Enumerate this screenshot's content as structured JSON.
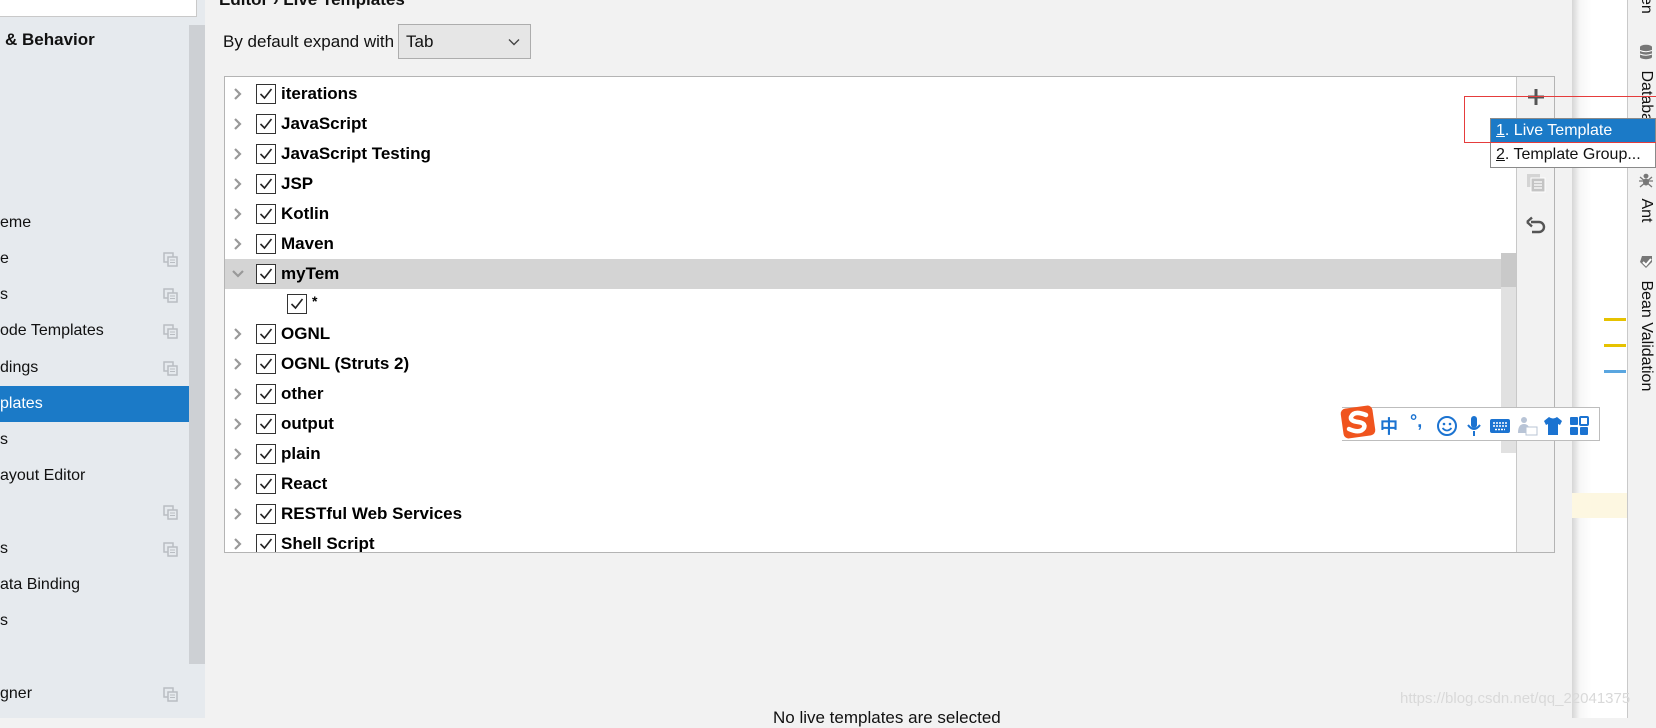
{
  "sidebar": {
    "header": "& Behavior",
    "items": [
      {
        "label": "eme",
        "has_copy": false,
        "selected": false
      },
      {
        "label": "e",
        "has_copy": true,
        "selected": false
      },
      {
        "label": "s",
        "has_copy": true,
        "selected": false
      },
      {
        "label": "ode Templates",
        "has_copy": true,
        "selected": false
      },
      {
        "label": "dings",
        "has_copy": true,
        "selected": false
      },
      {
        "label": "plates",
        "has_copy": false,
        "selected": true
      },
      {
        "label": "s",
        "has_copy": false,
        "selected": false
      },
      {
        "label": "ayout Editor",
        "has_copy": false,
        "selected": false
      },
      {
        "label": "",
        "has_copy": true,
        "selected": false
      },
      {
        "label": "s",
        "has_copy": true,
        "selected": false
      },
      {
        "label": "ata Binding",
        "has_copy": false,
        "selected": false
      },
      {
        "label": "s",
        "has_copy": false,
        "selected": false
      },
      {
        "label": "gner",
        "has_copy": true,
        "selected": false
      }
    ]
  },
  "main": {
    "breadcrumb": "Editor  ›  Live Templates",
    "expand_label": "By default expand with",
    "expand_value": "Tab",
    "help_text": "No live templates are selected"
  },
  "template_groups": [
    {
      "label": "iterations",
      "checked": true,
      "expanded": false,
      "level": 0
    },
    {
      "label": "JavaScript",
      "checked": true,
      "expanded": false,
      "level": 0
    },
    {
      "label": "JavaScript Testing",
      "checked": true,
      "expanded": false,
      "level": 0
    },
    {
      "label": "JSP",
      "checked": true,
      "expanded": false,
      "level": 0
    },
    {
      "label": "Kotlin",
      "checked": true,
      "expanded": false,
      "level": 0
    },
    {
      "label": "Maven",
      "checked": true,
      "expanded": false,
      "level": 0
    },
    {
      "label": "myTem",
      "checked": true,
      "expanded": true,
      "level": 0,
      "selected": true
    },
    {
      "label": "*",
      "checked": true,
      "expanded": false,
      "level": 1
    },
    {
      "label": "OGNL",
      "checked": true,
      "expanded": false,
      "level": 0
    },
    {
      "label": "OGNL (Struts 2)",
      "checked": true,
      "expanded": false,
      "level": 0
    },
    {
      "label": "other",
      "checked": true,
      "expanded": false,
      "level": 0
    },
    {
      "label": "output",
      "checked": true,
      "expanded": false,
      "level": 0
    },
    {
      "label": "plain",
      "checked": true,
      "expanded": false,
      "level": 0
    },
    {
      "label": "React",
      "checked": true,
      "expanded": false,
      "level": 0
    },
    {
      "label": "RESTful Web Services",
      "checked": true,
      "expanded": false,
      "level": 0
    },
    {
      "label": "Shell Script",
      "checked": true,
      "expanded": false,
      "level": 0
    }
  ],
  "toolbar": {
    "add_icon": "plus-icon",
    "copy_icon": "copy-icon",
    "revert_icon": "undo-icon"
  },
  "popup": {
    "items": [
      {
        "mnemonic": "1",
        "rest": ". Live Template",
        "active": true
      },
      {
        "mnemonic": "2",
        "rest": ". Template Group...",
        "active": false
      }
    ]
  },
  "tool_windows": {
    "top_partial": "en",
    "database": "Database",
    "ant": "Ant",
    "bean_validation": "Bean Validation"
  },
  "ime": {
    "lang": "中",
    "punct": "°,"
  },
  "watermark": "https://blog.csdn.net/qq_22041375",
  "colors": {
    "accent": "#1b7ac7",
    "highlight_border": "#e53c3c",
    "ime_blue": "#1b73d1",
    "ime_logo": "#f0541e",
    "marker_yellow": "#e6c200",
    "marker_blue": "#5aa6e0"
  }
}
